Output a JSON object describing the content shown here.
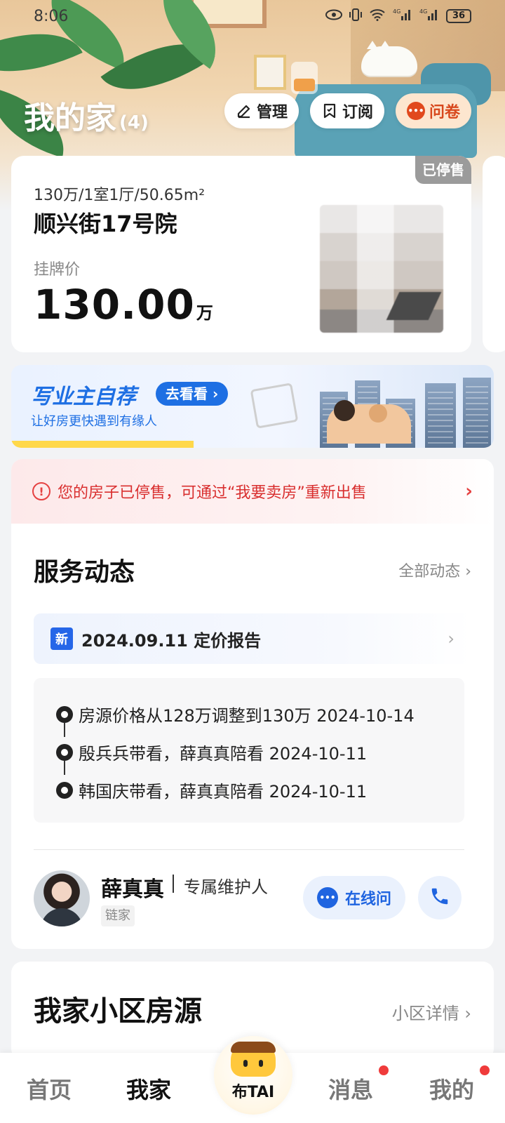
{
  "status_bar": {
    "time": "8:06",
    "battery": "36",
    "network_label": "4G"
  },
  "header": {
    "title": "我的家",
    "count": "(4)",
    "actions": [
      {
        "label": "管理",
        "icon": "edit-icon"
      },
      {
        "label": "订阅",
        "icon": "bookmark-icon"
      },
      {
        "label": "问卷",
        "icon": "survey-icon"
      }
    ]
  },
  "listing": {
    "status_tag": "已停售",
    "summary": "130万/1室1厅/50.65m²",
    "name": "顺兴街17号院",
    "price_label": "挂牌价",
    "price_value": "130.00",
    "price_unit": "万"
  },
  "banner": {
    "title": "写业主自荐",
    "cta": "去看看 ›",
    "subtitle": "让好房更快遇到有缘人"
  },
  "alert": {
    "text": "您的房子已停售，可通过“我要卖房”重新出售",
    "icon": "!"
  },
  "service": {
    "title": "服务动态",
    "link": "全部动态 ›",
    "report": {
      "badge": "新",
      "text": "2024.09.11 定价报告"
    },
    "timeline": [
      {
        "text": "房源价格从128万调整到130万 2024-10-14"
      },
      {
        "text": "殷兵兵带看，薛真真陪看 2024-10-11"
      },
      {
        "text": "韩国庆带看，薛真真陪看 2024-10-11"
      }
    ]
  },
  "agent": {
    "name": "薛真真",
    "role": "专属维护人",
    "company": "链家",
    "chat_label": "在线问"
  },
  "community": {
    "title": "我家小区房源",
    "link": "小区详情 ›"
  },
  "bottom_nav": {
    "items": [
      {
        "label": "首页",
        "active": false
      },
      {
        "label": "我家",
        "active": true
      },
      {
        "label": "布TAI",
        "active": false
      },
      {
        "label": "消息",
        "active": false,
        "badge": true
      },
      {
        "label": "我的",
        "active": false,
        "badge": true
      }
    ]
  },
  "colors": {
    "accent_blue": "#1e6fe3",
    "alert_red": "#d92f2f",
    "survey_orange": "#e1491d",
    "badge_red": "#ef3b3b"
  }
}
